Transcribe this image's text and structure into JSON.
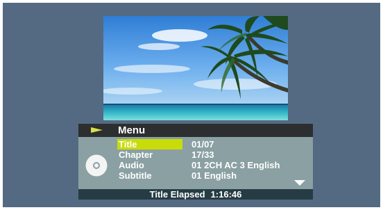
{
  "menu": {
    "title": "Menu",
    "items": [
      {
        "label": "Title",
        "value": "01/07"
      },
      {
        "label": "Chapter",
        "value": "17/33"
      },
      {
        "label": "Audio",
        "value": "01 2CH AC 3 English"
      },
      {
        "label": "Subtitle",
        "value": "01 English"
      }
    ],
    "selected_index": 0
  },
  "status": {
    "label": "Title Elapsed",
    "time": "1:16:46"
  },
  "icons": {
    "header": "play-arrow-icon",
    "disc": "disc-icon",
    "more": "scroll-down-arrow-icon"
  },
  "colors": {
    "screen_bg": "#546a82",
    "osd_bg": "#8aa0a2",
    "highlight": "#c8dc0a",
    "header_bg": "#2c2e30",
    "footer_bg": "#263c44"
  }
}
